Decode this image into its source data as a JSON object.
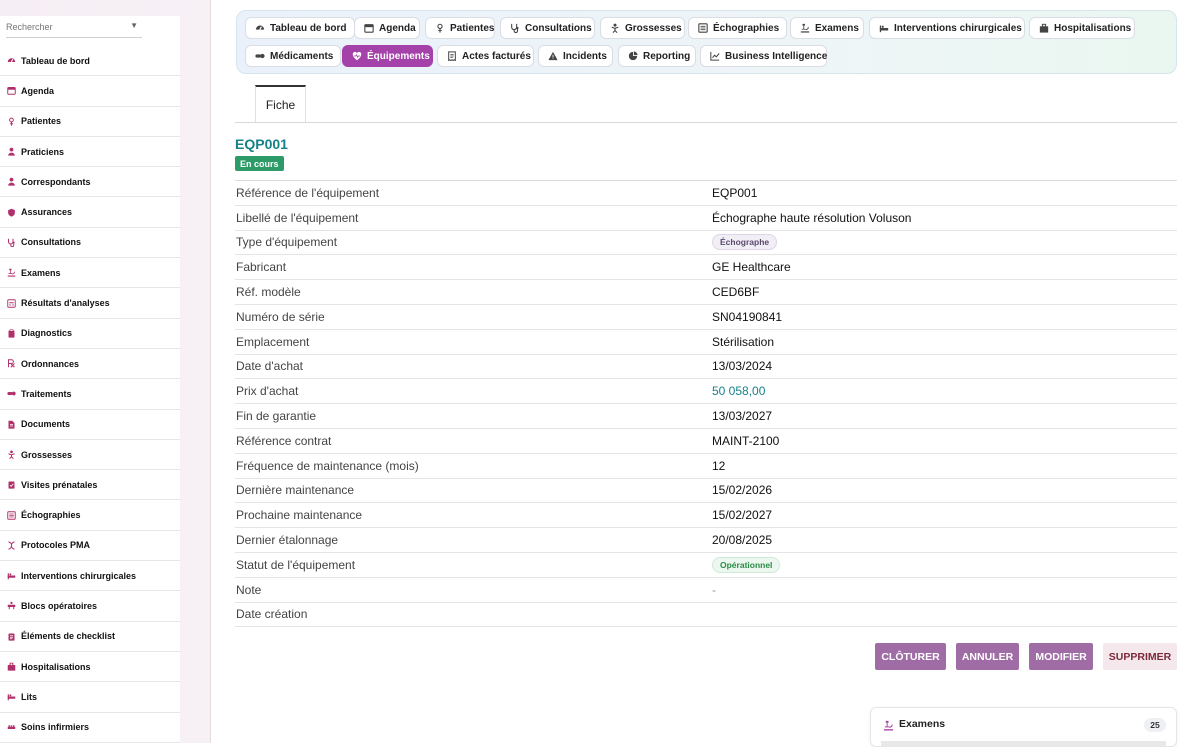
{
  "colors": {
    "accent": "#a542a9",
    "teal": "#17818a",
    "status_green": "#2d9b68",
    "button": "#a06ca6",
    "danger_bg": "#f4e8ec"
  },
  "sidebar": {
    "search_placeholder": "Rechercher",
    "items": [
      {
        "label": "Tableau de bord",
        "icon": "dashboard-icon"
      },
      {
        "label": "Agenda",
        "icon": "calendar-icon"
      },
      {
        "label": "Patientes",
        "icon": "female-icon"
      },
      {
        "label": "Praticiens",
        "icon": "doctor-icon"
      },
      {
        "label": "Correspondants",
        "icon": "user-icon"
      },
      {
        "label": "Assurances",
        "icon": "shield-icon"
      },
      {
        "label": "Consultations",
        "icon": "stethoscope-icon"
      },
      {
        "label": "Examens",
        "icon": "microscope-icon"
      },
      {
        "label": "Résultats d'analyses",
        "icon": "lab-results-icon"
      },
      {
        "label": "Diagnostics",
        "icon": "clipboard-icon"
      },
      {
        "label": "Ordonnances",
        "icon": "prescription-icon"
      },
      {
        "label": "Traitements",
        "icon": "pills-icon"
      },
      {
        "label": "Documents",
        "icon": "document-icon"
      },
      {
        "label": "Grossesses",
        "icon": "baby-icon"
      },
      {
        "label": "Visites prénatales",
        "icon": "clipboard-check-icon"
      },
      {
        "label": "Échographies",
        "icon": "ultrasound-icon"
      },
      {
        "label": "Protocoles PMA",
        "icon": "dna-icon"
      },
      {
        "label": "Interventions chirurgicales",
        "icon": "bed-icon"
      },
      {
        "label": "Blocs opératoires",
        "icon": "operating-room-icon"
      },
      {
        "label": "Éléments de checklist",
        "icon": "checklist-icon"
      },
      {
        "label": "Hospitalisations",
        "icon": "hospital-icon"
      },
      {
        "label": "Lits",
        "icon": "bed-icon"
      },
      {
        "label": "Soins infirmiers",
        "icon": "nurse-care-icon"
      }
    ]
  },
  "tabs": [
    {
      "label": "Tableau de bord",
      "icon": "dashboard-icon"
    },
    {
      "label": "Agenda",
      "icon": "calendar-icon"
    },
    {
      "label": "Patientes",
      "icon": "female-icon"
    },
    {
      "label": "Consultations",
      "icon": "stethoscope-icon"
    },
    {
      "label": "Grossesses",
      "icon": "baby-icon"
    },
    {
      "label": "Échographies",
      "icon": "ultrasound-icon"
    },
    {
      "label": "Examens",
      "icon": "microscope-icon"
    },
    {
      "label": "Interventions chirurgicales",
      "icon": "bed-icon"
    },
    {
      "label": "Hospitalisations",
      "icon": "hospital-icon"
    },
    {
      "label": "Médicaments",
      "icon": "pills-icon"
    },
    {
      "label": "Équipements",
      "icon": "heart-pulse-icon",
      "active": true
    },
    {
      "label": "Actes facturés",
      "icon": "invoice-icon"
    },
    {
      "label": "Incidents",
      "icon": "warning-icon"
    },
    {
      "label": "Reporting",
      "icon": "pie-chart-icon"
    },
    {
      "label": "Business Intelligence",
      "icon": "line-chart-icon"
    }
  ],
  "fiche_tab": "Fiche",
  "equipment": {
    "code": "EQP001",
    "status": "En cours"
  },
  "details": [
    {
      "label": "Référence de l'équipement",
      "value": "EQP001",
      "kind": "text"
    },
    {
      "label": "Libellé de l'équipement",
      "value": "Échographe haute résolution Voluson",
      "kind": "text"
    },
    {
      "label": "Type d'équipement",
      "value": "Échographe",
      "kind": "pill-purple"
    },
    {
      "label": "Fabricant",
      "value": "GE Healthcare",
      "kind": "text"
    },
    {
      "label": "Réf. modèle",
      "value": "CED6BF",
      "kind": "text"
    },
    {
      "label": "Numéro de série",
      "value": "SN04190841",
      "kind": "text"
    },
    {
      "label": "Emplacement",
      "value": "Stérilisation",
      "kind": "text"
    },
    {
      "label": "Date d'achat",
      "value": "13/03/2024",
      "kind": "text"
    },
    {
      "label": "Prix d'achat",
      "value": "50 058,00",
      "kind": "link"
    },
    {
      "label": "Fin de garantie",
      "value": "13/03/2027",
      "kind": "text"
    },
    {
      "label": "Référence contrat",
      "value": "MAINT-2100",
      "kind": "text"
    },
    {
      "label": "Fréquence de maintenance (mois)",
      "value": "12",
      "kind": "text"
    },
    {
      "label": "Dernière maintenance",
      "value": "15/02/2026",
      "kind": "text"
    },
    {
      "label": "Prochaine maintenance",
      "value": "15/02/2027",
      "kind": "text"
    },
    {
      "label": "Dernier étalonnage",
      "value": "20/08/2025",
      "kind": "text"
    },
    {
      "label": "Statut de l'équipement",
      "value": "Opérationnel",
      "kind": "pill-green"
    },
    {
      "label": "Note",
      "value": "-",
      "kind": "muted"
    },
    {
      "label": "Date création",
      "value": "",
      "kind": "text"
    }
  ],
  "actions": {
    "close": "CLÔTURER",
    "cancel": "ANNULER",
    "edit": "MODIFIER",
    "delete": "SUPPRIMER"
  },
  "exams_card": {
    "title": "Examens",
    "count": "25"
  }
}
